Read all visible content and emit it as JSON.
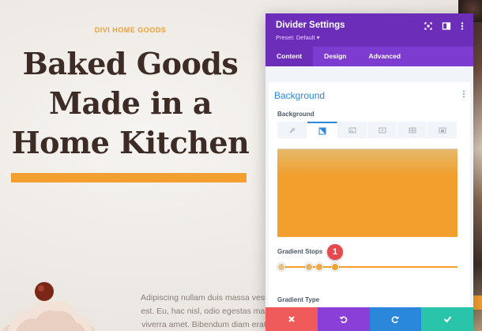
{
  "hero": {
    "eyebrow": "DIVI HOME GOODS",
    "title": "Baked Goods\nMade in a\nHome Kitchen",
    "body": "Adipiscing nullam duis massa vest\nest. Eu, hac nisl, odio egestas mal\nviverra amet. Bibendum diam erat lobortis"
  },
  "modal": {
    "title": "Divider Settings",
    "preset": "Preset: Default ▾",
    "header_icons": [
      "expand-icon",
      "sidebar-icon",
      "more-icon"
    ],
    "tabs": [
      {
        "label": "Content",
        "active": true
      },
      {
        "label": "Design",
        "active": false
      },
      {
        "label": "Advanced",
        "active": false
      }
    ],
    "section_title": "Background",
    "background_label": "Background",
    "background_tabs": [
      "none-icon",
      "gradient-icon",
      "image-icon",
      "video-icon",
      "pattern-icon",
      "mask-icon"
    ],
    "gradient_stops_label": "Gradient Stops",
    "gradient_stop_colors": [
      "#e2c18a",
      "#e4b46a",
      "#eea846",
      "#f29f2e"
    ],
    "gradient_type_label": "Gradient Type",
    "badge": "1",
    "footer_buttons": [
      {
        "name": "discard",
        "glyph": "✕",
        "color": "#ef5a5a"
      },
      {
        "name": "undo",
        "glyph": "↺",
        "color": "#8a3fd8"
      },
      {
        "name": "redo",
        "glyph": "↻",
        "color": "#2b87da"
      },
      {
        "name": "save",
        "glyph": "✓",
        "color": "#29c4a9"
      }
    ]
  },
  "colors": {
    "accent": "#f29f2e",
    "modal_purple": "#6c2eb9",
    "link_blue": "#2b87da"
  }
}
